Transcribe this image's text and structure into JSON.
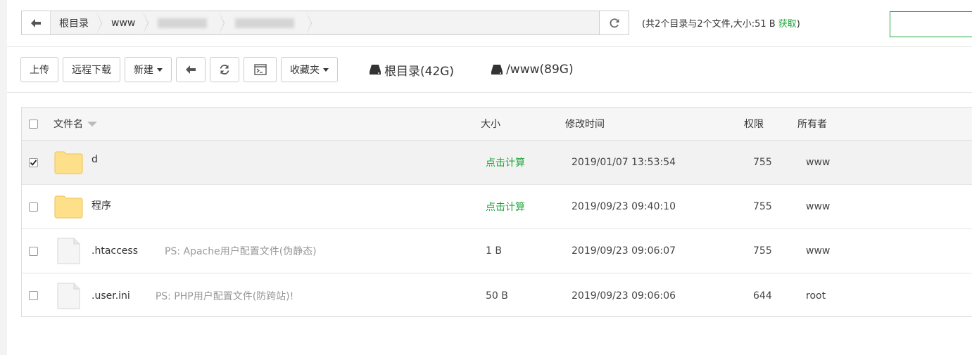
{
  "pathbar": {
    "crumbs": [
      "根目录",
      "www"
    ],
    "summary_prefix": "(共2个目录与2个文件,大小:51 B",
    "summary_fetch": "获取",
    "summary_suffix": ")"
  },
  "toolbar": {
    "upload": "上传",
    "remote_download": "远程下载",
    "new": "新建",
    "favorites": "收藏夹",
    "disks": [
      {
        "label": "根目录(42G)"
      },
      {
        "label": "/www(89G)"
      }
    ]
  },
  "table": {
    "headers": {
      "name": "文件名",
      "size": "大小",
      "mtime": "修改时间",
      "perm": "权限",
      "owner": "所有者"
    },
    "rows": [
      {
        "type": "folder",
        "name": "d",
        "ps": "",
        "size": "点击计算",
        "mtime": "2019/01/07 13:53:54",
        "perm": "755",
        "owner": "www",
        "checked": true
      },
      {
        "type": "folder",
        "name": "程序",
        "ps": "",
        "size": "点击计算",
        "mtime": "2019/09/23 09:40:10",
        "perm": "755",
        "owner": "www",
        "checked": false
      },
      {
        "type": "file",
        "name": ".htaccess",
        "ps": "PS: Apache用户配置文件(伪静态)",
        "size": "1 B",
        "mtime": "2019/09/23 09:06:07",
        "perm": "755",
        "owner": "www",
        "checked": false
      },
      {
        "type": "file",
        "name": ".user.ini",
        "ps": "PS: PHP用户配置文件(防跨站)!",
        "size": "50 B",
        "mtime": "2019/09/23 09:06:06",
        "perm": "644",
        "owner": "root",
        "checked": false
      }
    ]
  },
  "colors": {
    "accent": "#20a53a",
    "folder": "#ffe08a",
    "folder_border": "#f0c24e"
  },
  "icons": [
    "arrow-left-icon",
    "refresh-icon",
    "terminal-icon",
    "hdd-icon",
    "folder-icon",
    "file-icon",
    "checkbox-checked-icon"
  ]
}
